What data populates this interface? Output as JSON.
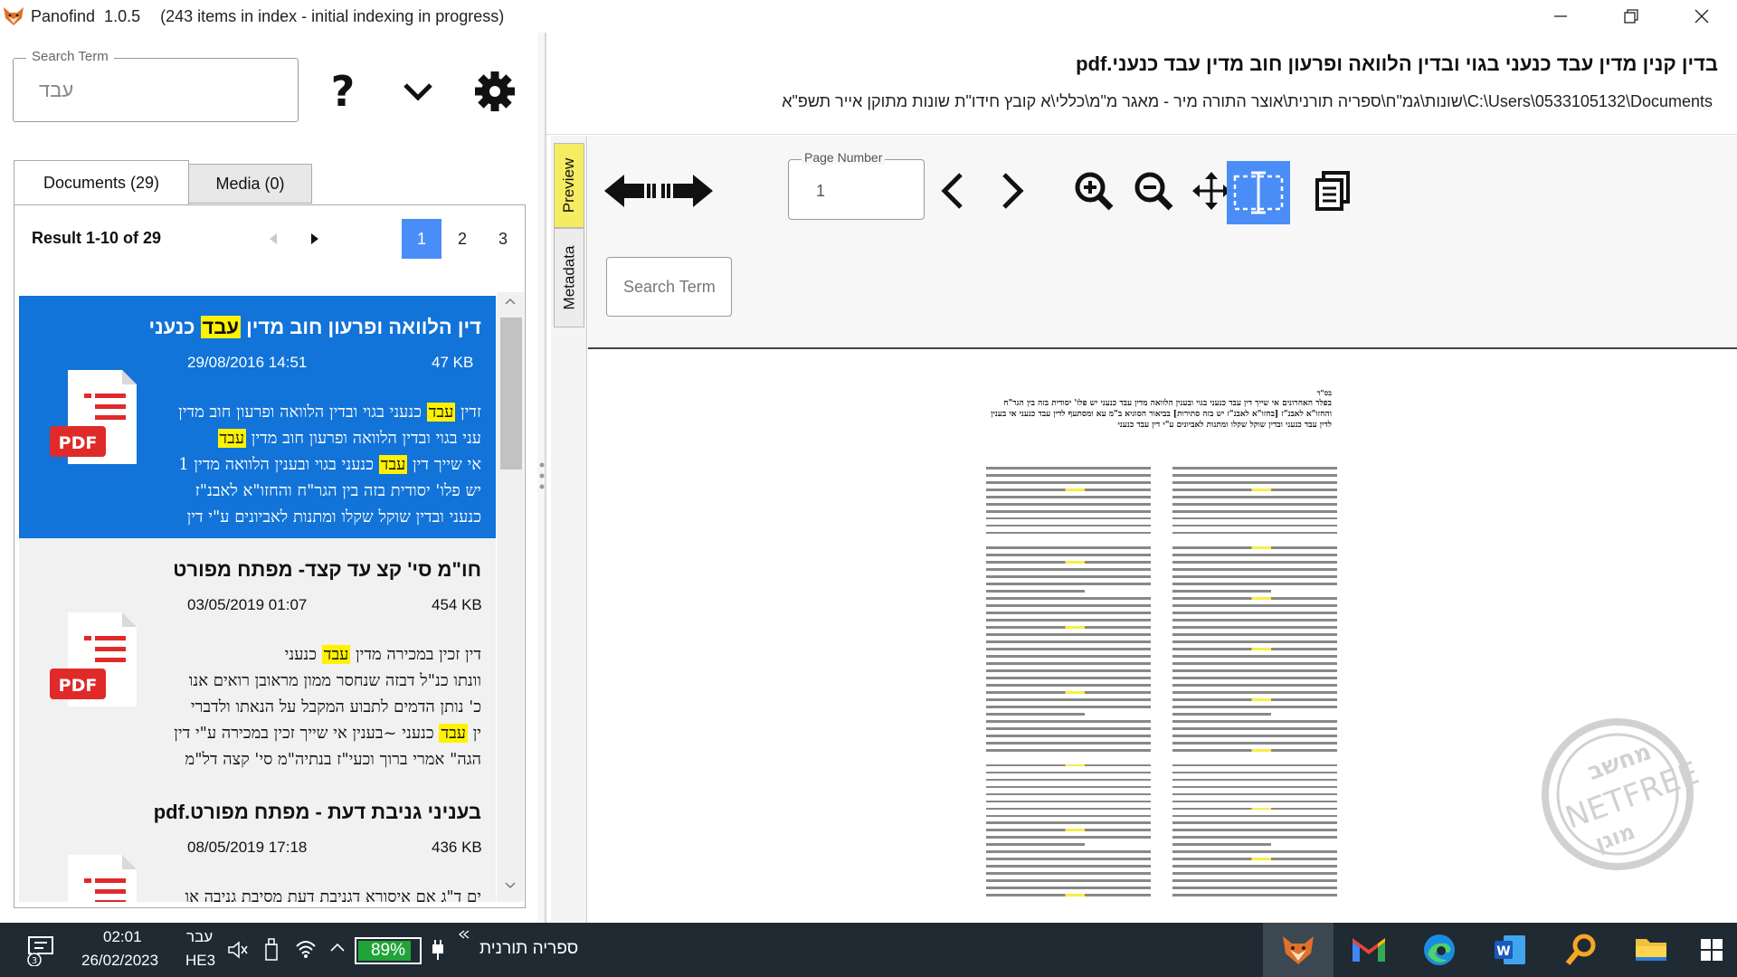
{
  "window": {
    "app_name": "Panofind  1.0.5",
    "status": "(243 items in index - initial indexing in progress)"
  },
  "search": {
    "legend": "Search Term",
    "value": "עבד"
  },
  "tabs": [
    {
      "label": "Documents (29)",
      "active": true
    },
    {
      "label": "Media (0)",
      "active": false
    }
  ],
  "results": {
    "summary": "Result 1-10 of 29",
    "pages": [
      "1",
      "2",
      "3"
    ],
    "current_page": "1",
    "items": [
      {
        "title_pre": "דין הלוואה ופרעון חוב מדין ",
        "title_hl": "עבד",
        "title_post": " כנעני",
        "date": "29/08/2016 14:51",
        "size": "47 KB",
        "snippet": [
          {
            "pre": "זדין ",
            "hl": "עבד",
            "post": " כנעני בגוי ובדין הלוואה ופרעון חוב מדין"
          },
          {
            "pre": "עני בגוי ובדין הלוואה ופרעון חוב מדין ",
            "hl": "עבד",
            "post": ""
          },
          {
            "pre": "אי שייך דין ",
            "hl": "עבד",
            "post": " כנעני בגוי ובענין הלוואה מדין 1"
          },
          {
            "pre": "יש פלו' יסודית בזה בין הגר\"ח והחזו\"א לאבנ\"ז",
            "hl": "",
            "post": ""
          },
          {
            "pre": "כנעני ובדין שוקל שקלו ומתנות לאביונים ע\"י דין",
            "hl": "",
            "post": ""
          }
        ],
        "selected": true,
        "icon": "pdf-file-icon"
      },
      {
        "title_pre": "חו\"מ סי' קצ עד קצד- מפתח מפורט",
        "title_hl": "",
        "title_post": "",
        "date": "03/05/2019 01:07",
        "size": "454 KB",
        "snippet": [
          {
            "pre": "דין זכין במכירה מדין ",
            "hl": "עבד",
            "post": " כנעני"
          },
          {
            "pre": "וונתו כנ\"ל דבזה שנחסר ממון מראובן רואים אנו",
            "hl": "",
            "post": ""
          },
          {
            "pre": "כ' נותן הדמים לתבוע המקבל על הנאתו ולדברי",
            "hl": "",
            "post": ""
          },
          {
            "pre": "ין ",
            "hl": "עבד",
            "post": " כנעני ~בענין אי שייך זכין במכירה ע\"י דין"
          },
          {
            "pre": "הגה\" אמרי ברוך וכעי\"ז בנתיה\"מ סי' קצה דל\"מ",
            "hl": "",
            "post": ""
          }
        ],
        "selected": false,
        "icon": "pdf-file-icon"
      },
      {
        "title_pre": "בעניני גניבת דעת - מפתח מפורט.pdf",
        "title_hl": "",
        "title_post": "",
        "date": "08/05/2019 17:18",
        "size": "436 KB",
        "snippet": [
          {
            "pre": "ים ד\"ג אם איסורא דגניבת דעת מסיבת גניבה או",
            "hl": "",
            "post": ""
          }
        ],
        "selected": false,
        "icon": "pdf-file-icon"
      }
    ]
  },
  "document": {
    "title": "בדין קנין מדין עבד כנעני בגוי ובדין הלוואה ופרעון חוב מדין עבד כנעני.pdf",
    "path": "C:\\Users\\0533105132\\Documents\\שונות\\גמ\"ח\\ספריה תורנית\\אוצר התורה מיר - מאגר מ\"מ\\כללי\\א קובץ חידו\"ת שונות מתוקן אייר תשפ\"א"
  },
  "viewer": {
    "side_tabs": [
      "Preview",
      "Metadata"
    ],
    "page_legend": "Page Number",
    "page_value": "1",
    "search_placeholder": "Search Term",
    "tools": [
      "first-page-icon",
      "last-page-icon",
      "prev-page-icon",
      "next-page-icon",
      "zoom-in-icon",
      "zoom-out-icon",
      "pan-icon",
      "text-select-icon",
      "copy-icon"
    ],
    "active_tool": "text-select-icon"
  },
  "pdf_preview": {
    "header": "בס\"ד",
    "heading": "בפלר האחרונים אי שייך דין עבד כנעני בגוי ובענין הלוואה מדין עבד כנעני יש פלו' יסודית בזה בין הגר\"ח והחזו\"א לאבנ\"ז [בחזו\"א לאבנ\"ז יש בזה סתירות] בביאור הסוגיא ב\"מ עא ומסתעף לדין עבד כנעני אי בענין לדין עבד כנעני ובדין שוקל שקלו ומתנות לאביונים ע\"י דין עבד כנעני"
  },
  "stamp": {
    "text_top": "מחשב",
    "text_mid": "NETFREE",
    "text_bottom": "מוגן"
  },
  "taskbar": {
    "notification_count": "3",
    "time": "02:01",
    "date": "26/02/2023",
    "lang_top": "עבר",
    "lang_bottom": "HE3",
    "battery": "89%",
    "battery_level": 0.89,
    "tray_label": "ספריה תורנית",
    "apps": [
      "panofind-icon",
      "gmail-icon",
      "edge-icon",
      "word-icon",
      "search-app-icon",
      "folder-icon",
      "windows-icon"
    ],
    "colors": {
      "battery_fill": "#22a33a",
      "accent": "#1273d8",
      "highlight": "#fff200"
    }
  }
}
